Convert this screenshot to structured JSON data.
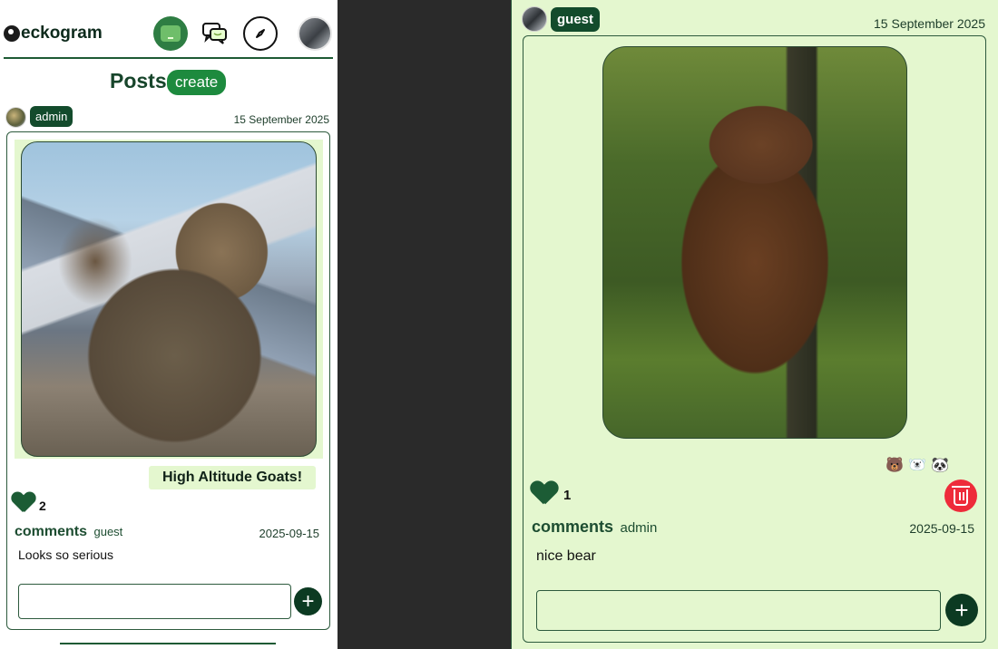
{
  "app": {
    "logo_text": "eckogram",
    "nav": {
      "home_icon": "home-icon",
      "chat_icon": "chat-bubbles-icon",
      "explore_icon": "compass-icon",
      "profile_icon": "avatar"
    }
  },
  "left_panel": {
    "title": "Posts",
    "create_label": "create",
    "post": {
      "author_role": "admin",
      "date": "15 September 2025",
      "caption": "High Altitude Goats!",
      "likes": "2",
      "comments_label": "comments",
      "comment_user": "guest",
      "comment_date": "2025-09-15",
      "comment_text": "Looks so serious",
      "comment_input_placeholder": "",
      "add_label": "+"
    }
  },
  "right_panel": {
    "post": {
      "author_role": "guest",
      "date": "15 September 2025",
      "reactions": [
        "🐻",
        "🐻‍❄️",
        "🐼"
      ],
      "likes": "1",
      "comments_label": "comments",
      "comment_user": "admin",
      "comment_date": "2025-09-15",
      "comment_text": "nice bear",
      "comment_input_placeholder": "",
      "add_label": "+"
    }
  },
  "colors": {
    "brand_green": "#134b2c",
    "create_green": "#1d8a3e",
    "panel_bg": "#e4f7cf",
    "delete_red": "#ee2b3a"
  }
}
